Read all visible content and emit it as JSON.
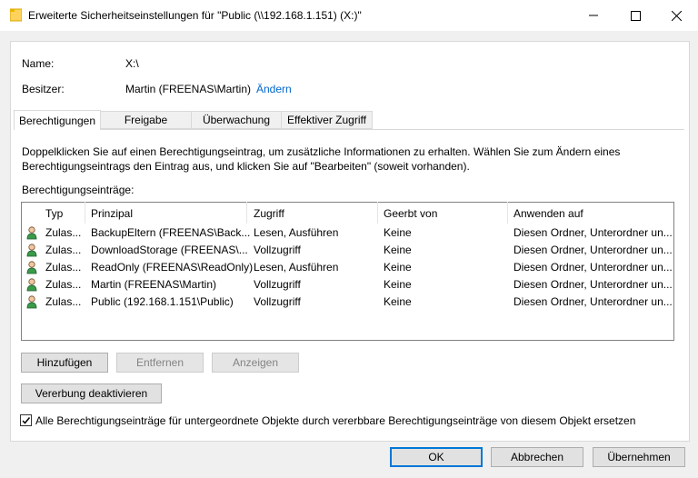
{
  "window": {
    "title": "Erweiterte Sicherheitseinstellungen für \"Public (\\\\192.168.1.151) (X:)\""
  },
  "info": {
    "name_label": "Name:",
    "name_value": "X:\\",
    "owner_label": "Besitzer:",
    "owner_value": "Martin (FREENAS\\Martin)",
    "change_link": "Ändern"
  },
  "tabs": [
    {
      "label": "Berechtigungen"
    },
    {
      "label": "Freigabe"
    },
    {
      "label": "Überwachung"
    },
    {
      "label": "Effektiver Zugriff"
    }
  ],
  "description": {
    "line1": "Doppelklicken Sie auf einen Berechtigungseintrag, um zusätzliche Informationen zu erhalten. Wählen Sie zum Ändern eines",
    "line2": "Berechtigungseintrags den Eintrag aus, und klicken Sie auf \"Bearbeiten\" (soweit vorhanden)."
  },
  "entries_label": "Berechtigungseinträge:",
  "columns": {
    "typ": "Typ",
    "prinzipal": "Prinzipal",
    "zugriff": "Zugriff",
    "geerbt": "Geerbt von",
    "anwenden": "Anwenden auf"
  },
  "rows": [
    {
      "typ": "Zulas...",
      "prinzipal": "BackupEltern (FREENAS\\Back...",
      "zugriff": "Lesen, Ausführen",
      "geerbt": "Keine",
      "anwenden": "Diesen Ordner, Unterordner un..."
    },
    {
      "typ": "Zulas...",
      "prinzipal": "DownloadStorage (FREENAS\\...",
      "zugriff": "Vollzugriff",
      "geerbt": "Keine",
      "anwenden": "Diesen Ordner, Unterordner un..."
    },
    {
      "typ": "Zulas...",
      "prinzipal": "ReadOnly (FREENAS\\ReadOnly)",
      "zugriff": "Lesen, Ausführen",
      "geerbt": "Keine",
      "anwenden": "Diesen Ordner, Unterordner un..."
    },
    {
      "typ": "Zulas...",
      "prinzipal": "Martin (FREENAS\\Martin)",
      "zugriff": "Vollzugriff",
      "geerbt": "Keine",
      "anwenden": "Diesen Ordner, Unterordner un..."
    },
    {
      "typ": "Zulas...",
      "prinzipal": "Public (192.168.1.151\\Public)",
      "zugriff": "Vollzugriff",
      "geerbt": "Keine",
      "anwenden": "Diesen Ordner, Unterordner un..."
    }
  ],
  "buttons": {
    "add": "Hinzufügen",
    "remove": "Entfernen",
    "view": "Anzeigen",
    "disable_inheritance": "Vererbung deaktivieren",
    "ok": "OK",
    "cancel": "Abbrechen",
    "apply": "Übernehmen"
  },
  "replace_checkbox": {
    "label": "Alle Berechtigungseinträge für untergeordnete Objekte durch vererbbare Berechtigungseinträge von diesem Objekt ersetzen",
    "checked": true
  },
  "colors": {
    "link": "#0066cc",
    "default_button_border": "#0078d7"
  }
}
